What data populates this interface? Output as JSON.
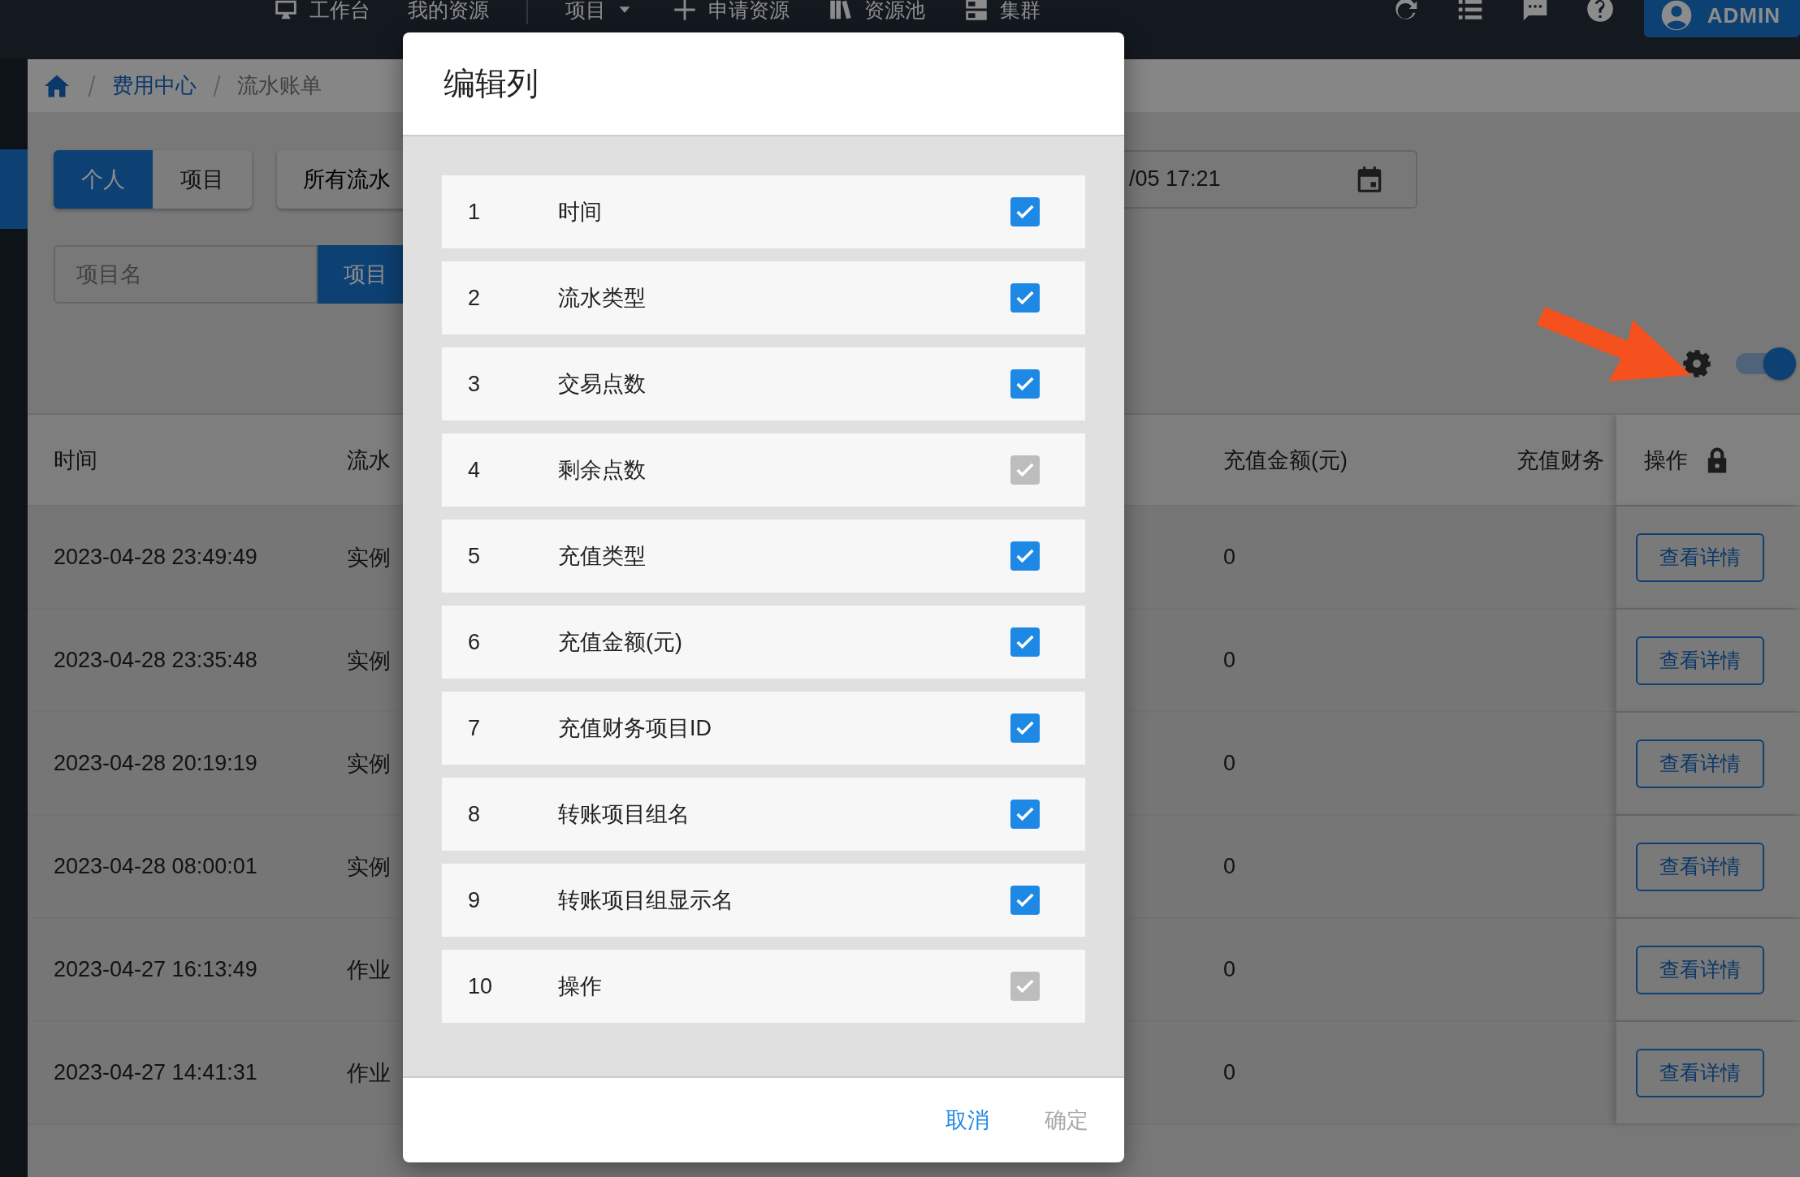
{
  "topbar": {
    "nav": [
      {
        "label": "工作台",
        "dropdown": false
      },
      {
        "label": "我的资源",
        "dropdown": false
      },
      {
        "label": "项目",
        "dropdown": true
      },
      {
        "label": "申请资源",
        "dropdown": false
      },
      {
        "label": "资源池",
        "dropdown": false
      },
      {
        "label": "集群",
        "dropdown": false
      }
    ],
    "user": "ADMIN"
  },
  "breadcrumb": [
    "费用中心",
    "流水账单"
  ],
  "filters": {
    "scope": [
      {
        "label": "个人",
        "selected": true
      },
      {
        "label": "项目",
        "selected": false
      }
    ],
    "flow_type": "所有流水",
    "date_field": {
      "value": "/05 17:21"
    },
    "search": {
      "placeholder": "项目名",
      "button": "项目"
    },
    "column_toggle": {
      "on": true
    }
  },
  "table": {
    "columns": {
      "time": "时间",
      "type": "流水",
      "amount": "充值金额(元)",
      "column_6": "充值财务",
      "action": "操作"
    },
    "rows": [
      {
        "time": "2023-04-28 23:49:49",
        "type": "实例",
        "amount": "0",
        "action": "查看详情"
      },
      {
        "time": "2023-04-28 23:35:48",
        "type": "实例",
        "amount": "0",
        "action": "查看详情"
      },
      {
        "time": "2023-04-28 20:19:19",
        "type": "实例",
        "amount": "0",
        "action": "查看详情"
      },
      {
        "time": "2023-04-28 08:00:01",
        "type": "实例",
        "amount": "0",
        "action": "查看详情"
      },
      {
        "time": "2023-04-27 16:13:49",
        "type": "作业",
        "amount": "0",
        "action": "查看详情"
      },
      {
        "time": "2023-04-27 14:41:31",
        "type": "作业",
        "amount": "0",
        "action": "查看详情"
      }
    ]
  },
  "dialog": {
    "title": "编辑列",
    "items": [
      {
        "index": "1",
        "label": "时间",
        "checked": true,
        "disabled": false
      },
      {
        "index": "2",
        "label": "流水类型",
        "checked": true,
        "disabled": false
      },
      {
        "index": "3",
        "label": "交易点数",
        "checked": true,
        "disabled": false
      },
      {
        "index": "4",
        "label": "剩余点数",
        "checked": true,
        "disabled": true
      },
      {
        "index": "5",
        "label": "充值类型",
        "checked": true,
        "disabled": false
      },
      {
        "index": "6",
        "label": "充值金额(元)",
        "checked": true,
        "disabled": false
      },
      {
        "index": "7",
        "label": "充值财务项目ID",
        "checked": true,
        "disabled": false
      },
      {
        "index": "8",
        "label": "转账项目组名",
        "checked": true,
        "disabled": false
      },
      {
        "index": "9",
        "label": "转账项目组显示名",
        "checked": true,
        "disabled": false
      },
      {
        "index": "10",
        "label": "操作",
        "checked": true,
        "disabled": true
      }
    ],
    "cancel": {
      "label": "取消",
      "disabled": false
    },
    "confirm": {
      "label": "确定",
      "disabled": true
    }
  }
}
